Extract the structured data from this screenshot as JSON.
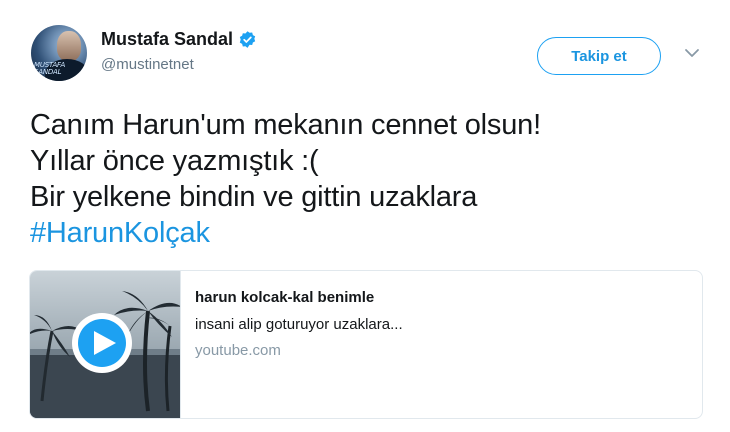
{
  "author": {
    "display_name": "Mustafa Sandal",
    "handle": "@mustinetnet",
    "verified": true,
    "avatar_text": "MUSTAFA SANDAL"
  },
  "actions": {
    "follow_label": "Takip et"
  },
  "tweet": {
    "lines": [
      "Canım Harun'um mekanın cennet olsun!",
      "Yıllar önce yazmıştık :(",
      "Bir yelkene bindin ve gittin uzaklara"
    ],
    "hashtag": "#HarunKolçak"
  },
  "card": {
    "title": "harun kolcak-kal benimle",
    "description": "insani alip goturuyor uzaklara...",
    "domain": "youtube.com"
  },
  "colors": {
    "accent": "#1da1f2",
    "hashtag": "#1b95e0",
    "text": "#14171a",
    "muted": "#657786",
    "border": "#e1e8ed"
  },
  "icons": {
    "verified": "verified-badge-icon",
    "chevron": "chevron-down-icon",
    "play": "play-icon"
  }
}
